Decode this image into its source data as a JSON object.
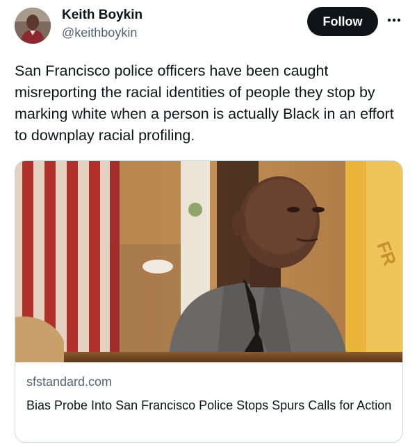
{
  "author": {
    "display_name": "Keith Boykin",
    "handle": "@keithboykin"
  },
  "actions": {
    "follow_label": "Follow",
    "more_icon": "more-horizontal-icon"
  },
  "tweet": {
    "text": "San Francisco police officers have been caught misreporting the racial identities of people they stop by marking white when a person is actually Black in an effort to downplay racial profiling."
  },
  "link_card": {
    "domain": "sfstandard.com",
    "title": "Bias Probe Into San Francisco Police Stops Spurs Calls for Action",
    "image_flag_text": "FR"
  },
  "colors": {
    "text_primary": "#0f1419",
    "text_secondary": "#536471",
    "follow_bg": "#0f1419",
    "follow_text": "#ffffff",
    "card_border": "#cfd9de"
  }
}
